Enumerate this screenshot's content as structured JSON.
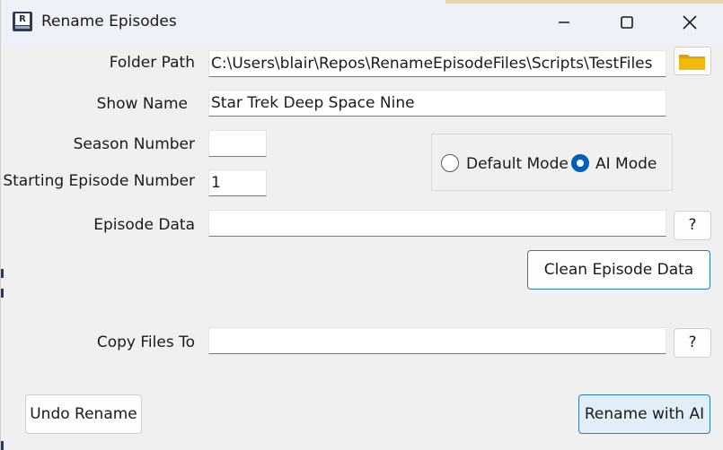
{
  "window": {
    "title": "Rename Episodes",
    "app_icon_letter": "R"
  },
  "form": {
    "folder_path_label": "Folder Path",
    "folder_path_value": "C:\\Users\\blair\\Repos\\RenameEpisodeFiles\\Scripts\\TestFiles",
    "show_name_label": "Show Name",
    "show_name_value": "Star Trek Deep Space Nine",
    "season_number_label": "Season Number",
    "season_number_value": "",
    "starting_episode_label": "Starting Episode Number",
    "starting_episode_value": "1",
    "episode_data_label": "Episode Data",
    "episode_data_value": "",
    "copy_files_label": "Copy Files To",
    "copy_files_value": ""
  },
  "mode": {
    "options": [
      {
        "label": "Default Mode",
        "checked": false
      },
      {
        "label": "AI Mode",
        "checked": true
      }
    ]
  },
  "buttons": {
    "episode_help": "?",
    "copy_help": "?",
    "clean_episode_data": "Clean Episode Data",
    "undo_rename": "Undo Rename",
    "rename_with_ai": "Rename with AI"
  },
  "icons": {
    "folder": "folder-icon",
    "minimize": "minimize-icon",
    "maximize": "maximize-icon",
    "close": "close-icon"
  },
  "colors": {
    "accent": "#2c7bbf",
    "radio_checked": "#005fb8",
    "folder": "#f2b90d"
  }
}
